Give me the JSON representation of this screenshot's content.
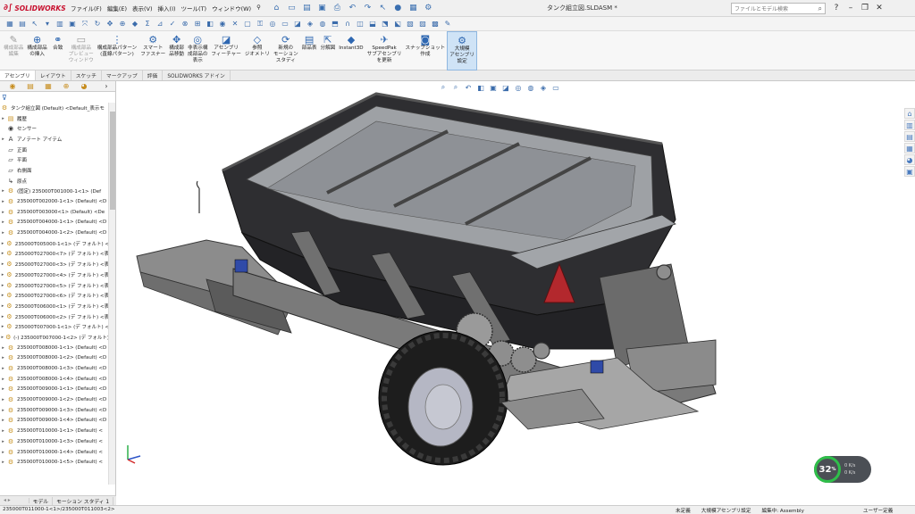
{
  "app": {
    "brand": "SOLIDWORKS",
    "document_title": "タンク組立図.SLDASM *",
    "search_placeholder": "ファイルとモデル検索"
  },
  "menu": [
    "ファイル(F)",
    "編集(E)",
    "表示(V)",
    "挿入(I)",
    "ツール(T)",
    "ウィンドウ(W)"
  ],
  "command_manager": {
    "buttons": [
      {
        "label": "構成部品\n編集",
        "icon": "edit-component-icon",
        "state": "disabled"
      },
      {
        "label": "構成部品\nの挿入",
        "icon": "insert-component-icon",
        "state": "normal"
      },
      {
        "label": "合致",
        "icon": "mate-icon",
        "state": "normal"
      },
      {
        "label": "構成部品\nプレビュー\nウィンドウ",
        "icon": "preview-window-icon",
        "state": "disabled"
      },
      {
        "label": "構成部品パターン\n(直線パターン)",
        "icon": "linear-pattern-icon",
        "state": "normal"
      },
      {
        "label": "スマート\nファスナー",
        "icon": "smart-fastener-icon",
        "state": "normal"
      },
      {
        "label": "構成部\n品移動",
        "icon": "move-component-icon",
        "state": "normal"
      },
      {
        "label": "非表示構\n成部品の\n表示",
        "icon": "show-hidden-icon",
        "state": "normal"
      },
      {
        "label": "アセンブリ\nフィーチャー",
        "icon": "assembly-feature-icon",
        "state": "normal"
      },
      {
        "label": "参照\nジオメトリ",
        "icon": "reference-geometry-icon",
        "state": "normal"
      },
      {
        "label": "新規の\nモーション\nスタディ",
        "icon": "motion-study-icon",
        "state": "normal"
      },
      {
        "label": "部品表",
        "icon": "bom-icon",
        "state": "normal"
      },
      {
        "label": "分解図",
        "icon": "exploded-view-icon",
        "state": "normal"
      },
      {
        "label": "Instant3D",
        "icon": "instant3d-icon",
        "state": "normal"
      },
      {
        "label": "SpeedPak\nサブアセンブリ\nを更新",
        "icon": "speedpak-icon",
        "state": "normal"
      },
      {
        "label": "スナップショット\n作成",
        "icon": "snapshot-icon",
        "state": "normal"
      },
      {
        "label": "大規模\nアセンブリ\n設定",
        "icon": "large-assembly-icon",
        "state": "active"
      }
    ],
    "tabs": [
      "アセンブリ",
      "レイアウト",
      "スケッチ",
      "マークアップ",
      "評価",
      "SOLIDWORKS アドイン"
    ],
    "active_tab": 0
  },
  "feature_tree": {
    "root": "タンク組立図 (Default) <Default_表示モ",
    "items": [
      {
        "label": "履歴",
        "icon": "history-folder-icon",
        "expand": true
      },
      {
        "label": "センサー",
        "icon": "sensor-icon",
        "expand": false
      },
      {
        "label": "アノテート アイテム",
        "icon": "annotation-icon",
        "expand": true
      },
      {
        "label": "正面",
        "icon": "plane-icon",
        "expand": false
      },
      {
        "label": "平面",
        "icon": "plane-icon",
        "expand": false
      },
      {
        "label": "右側面",
        "icon": "plane-icon",
        "expand": false
      },
      {
        "label": "原点",
        "icon": "origin-icon",
        "expand": false
      },
      {
        "label": "(固定) 235000T001000-1<1> (Def",
        "icon": "component-icon",
        "expand": true
      },
      {
        "label": "235000T002000-1<1> (Default) <D",
        "icon": "component-icon",
        "expand": true
      },
      {
        "label": "235000T003000<1> (Default) <De",
        "icon": "component-icon",
        "expand": true
      },
      {
        "label": "235000T004000-1<1> (Default) <D",
        "icon": "component-icon",
        "expand": true
      },
      {
        "label": "235000T004000-1<2> (Default) <D",
        "icon": "component-icon",
        "expand": true
      },
      {
        "label": "235000T005000-1<1> (デ フォルト) <",
        "icon": "component-icon",
        "expand": true
      },
      {
        "label": "235000T027000<7> (デ フォルト) <表",
        "icon": "component-icon",
        "expand": true
      },
      {
        "label": "235000T027000<3> (デ フォルト) <表",
        "icon": "component-icon",
        "expand": true
      },
      {
        "label": "235000T027000<4> (デ フォルト) <表",
        "icon": "component-icon",
        "expand": true
      },
      {
        "label": "235000T027000<5> (デ フォルト) <表",
        "icon": "component-icon",
        "expand": true
      },
      {
        "label": "235000T027000<6> (デ フォルト) <表",
        "icon": "component-icon",
        "expand": true
      },
      {
        "label": "235000T006000<1> (デ フォルト) <表",
        "icon": "component-icon",
        "expand": true
      },
      {
        "label": "235000T006000<2> (デ フォルト) <表",
        "icon": "component-icon",
        "expand": true
      },
      {
        "label": "235000T007000-1<1> (デ フォルト) <",
        "icon": "component-icon",
        "expand": true
      },
      {
        "label": "(-) 235000T007000-1<2> (デ フォルト)",
        "icon": "component-icon",
        "expand": true
      },
      {
        "label": "235000T008000-1<1> (Default) <D",
        "icon": "component-icon",
        "expand": true
      },
      {
        "label": "235000T008000-1<2> (Default) <D",
        "icon": "component-icon",
        "expand": true
      },
      {
        "label": "235000T008000-1<3> (Default) <D",
        "icon": "component-icon",
        "expand": true
      },
      {
        "label": "235000T008000-1<4> (Default) <D",
        "icon": "component-icon",
        "expand": true
      },
      {
        "label": "235000T009000-1<1> (Default) <D",
        "icon": "component-icon",
        "expand": true
      },
      {
        "label": "235000T009000-1<2> (Default) <D",
        "icon": "component-icon",
        "expand": true
      },
      {
        "label": "235000T009000-1<3> (Default) <D",
        "icon": "component-icon",
        "expand": true
      },
      {
        "label": "235000T009000-1<4> (Default) <D",
        "icon": "component-icon",
        "expand": true
      },
      {
        "label": "235000T010000-1<1> (Default) <",
        "icon": "component-icon",
        "expand": true
      },
      {
        "label": "235000T010000-1<3> (Default) <",
        "icon": "component-icon",
        "expand": true
      },
      {
        "label": "235000T010000-1<4> (Default) <",
        "icon": "component-icon",
        "expand": true
      },
      {
        "label": "235000T010000-1<5> (Default) <",
        "icon": "component-icon",
        "expand": true
      }
    ]
  },
  "bottom_tabs": [
    "モデル",
    "モーション スタディ 1"
  ],
  "status": {
    "selection": "235000T011000-1<1>/235000T011003<2>",
    "state1": "未定義",
    "state2": "大規模アセンブリ設定",
    "state3": "編集中: Assembly",
    "units": "ユーザー定義"
  },
  "performance": {
    "percent": "32",
    "percent_unit": "%",
    "stat1": "0 K/s",
    "stat2": "0 K/s"
  },
  "colors": {
    "accent": "#2e67b1",
    "brand_red": "#c8102e",
    "status_green": "#2fbf4a"
  }
}
